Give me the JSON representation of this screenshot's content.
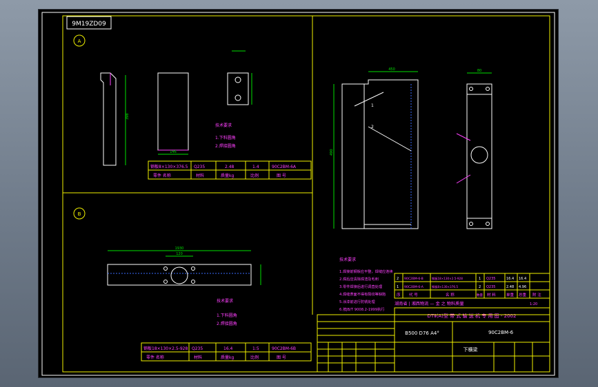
{
  "drawing": {
    "code_box": "9M19ZD09",
    "view_a": "A",
    "view_b": "B",
    "table_top": {
      "row1": [
        "钢板8×130×376.5",
        "Q235",
        "2.48",
        "1.4",
        "90C2BM-6A"
      ],
      "row2": [
        "零件 名称",
        "材料",
        "质量kg",
        "比例",
        "图 号"
      ]
    },
    "table_bottom": {
      "row1": [
        "钢板18×130×2.5-928",
        "Q235",
        "16.4",
        "1:5",
        "90C2BM-6B"
      ],
      "row2": [
        "零件 名称",
        "材料",
        "质量kg",
        "比例",
        "图 号"
      ]
    },
    "tech_notes_top": [
      "技术要求",
      "1.下料圆角",
      "2.焊接圆角"
    ],
    "tech_notes_bottom": [
      "技术要求",
      "1.下料圆角",
      "2.焊接圆角"
    ],
    "tech_notes_right": [
      "技术要求",
      "1.焊接前钢板应平整，焊缝应连续",
      "2.焊后应清除焊渣及毛刺",
      "3.零件焊接后进行调直处理",
      "4.焊缝表面不得有裂纹等缺陷",
      "5.涂漆前进行防锈处理",
      "6.按JB/T 9008.2-1999执行"
    ],
    "dim_labels": [
      "398",
      "146",
      "1930",
      "450",
      "490",
      "680",
      "120",
      "80"
    ],
    "parts_list": [
      [
        "2",
        "90C2BM-6-B",
        "钢板18×130×2.5-928",
        "1",
        "Q235",
        "16.4",
        "16.4"
      ],
      [
        "1",
        "90C2BM-6-A",
        "钢板8×130×376.5",
        "2",
        "Q235",
        "2.48",
        "4.96"
      ]
    ],
    "parts_header": [
      "序",
      "代 号",
      "名 称",
      "数量",
      "材 料",
      "单重",
      "总重",
      "附 注"
    ],
    "title_line1": "湖南省 | 湘西物流 — 金 之 物料质量",
    "title_line2": "DTⅡ(A)型 带 式 输 送 机 专 用 图 - 2002",
    "spec": "B500 D76 A4°",
    "drawing_no": "90C2BM-6",
    "part_name": "下横梁",
    "ratio_label": "1:20",
    "balloons": [
      "1",
      "2"
    ]
  }
}
